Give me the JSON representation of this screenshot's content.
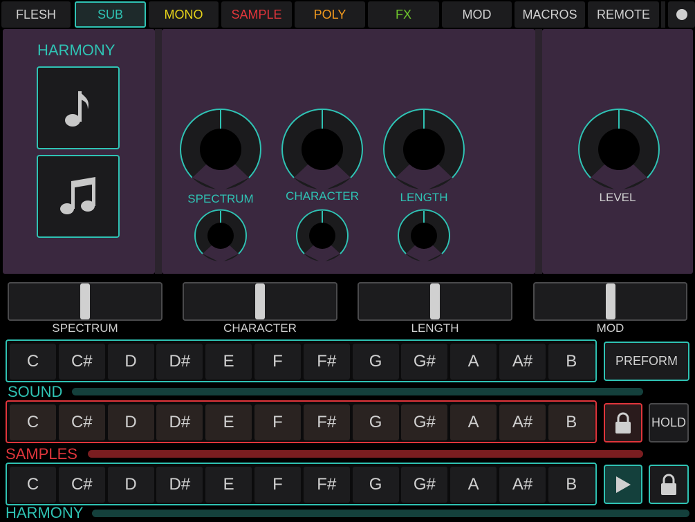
{
  "tabs": [
    {
      "label": "FLESH",
      "color": "#d0d0d0"
    },
    {
      "label": "SUB",
      "color": "#2fc3b4",
      "active": true
    },
    {
      "label": "MONO",
      "color": "#e6d21a"
    },
    {
      "label": "SAMPLE",
      "color": "#e0353b"
    },
    {
      "label": "POLY",
      "color": "#f39a1e"
    },
    {
      "label": "FX",
      "color": "#6fc62c"
    },
    {
      "label": "MOD",
      "color": "#d0d0d0"
    },
    {
      "label": "MACROS",
      "color": "#d0d0d0"
    },
    {
      "label": "REMOTE",
      "color": "#d0d0d0"
    }
  ],
  "harmony": {
    "title": "HARMONY",
    "buttons": [
      {
        "icon": "single-note-icon"
      },
      {
        "icon": "double-note-icon"
      }
    ]
  },
  "knobs": {
    "spectrum": {
      "label": "SPECTRUM"
    },
    "character": {
      "label": "CHARACTER"
    },
    "length": {
      "label": "LENGTH"
    },
    "level": {
      "label": "LEVEL"
    }
  },
  "sliders": [
    {
      "label": "SPECTRUM",
      "value": 0.5
    },
    {
      "label": "CHARACTER",
      "value": 0.5
    },
    {
      "label": "LENGTH",
      "value": 0.5
    },
    {
      "label": "MOD",
      "value": 0.5
    }
  ],
  "notes": [
    "C",
    "C#",
    "D",
    "D#",
    "E",
    "F",
    "F#",
    "G",
    "G#",
    "A",
    "A#",
    "B"
  ],
  "rows": {
    "sound": {
      "label": "SOUND",
      "side_button": "PREFORM",
      "color": "#2fc3b4"
    },
    "samples": {
      "label": "SAMPLES",
      "side_button": "HOLD",
      "color": "#e0353b"
    },
    "harmony": {
      "label": "HARMONY",
      "color": "#2fc3b4"
    }
  },
  "colors": {
    "accent": "#2fc3b4",
    "red": "#e0353b",
    "panel": "#3a283f"
  }
}
